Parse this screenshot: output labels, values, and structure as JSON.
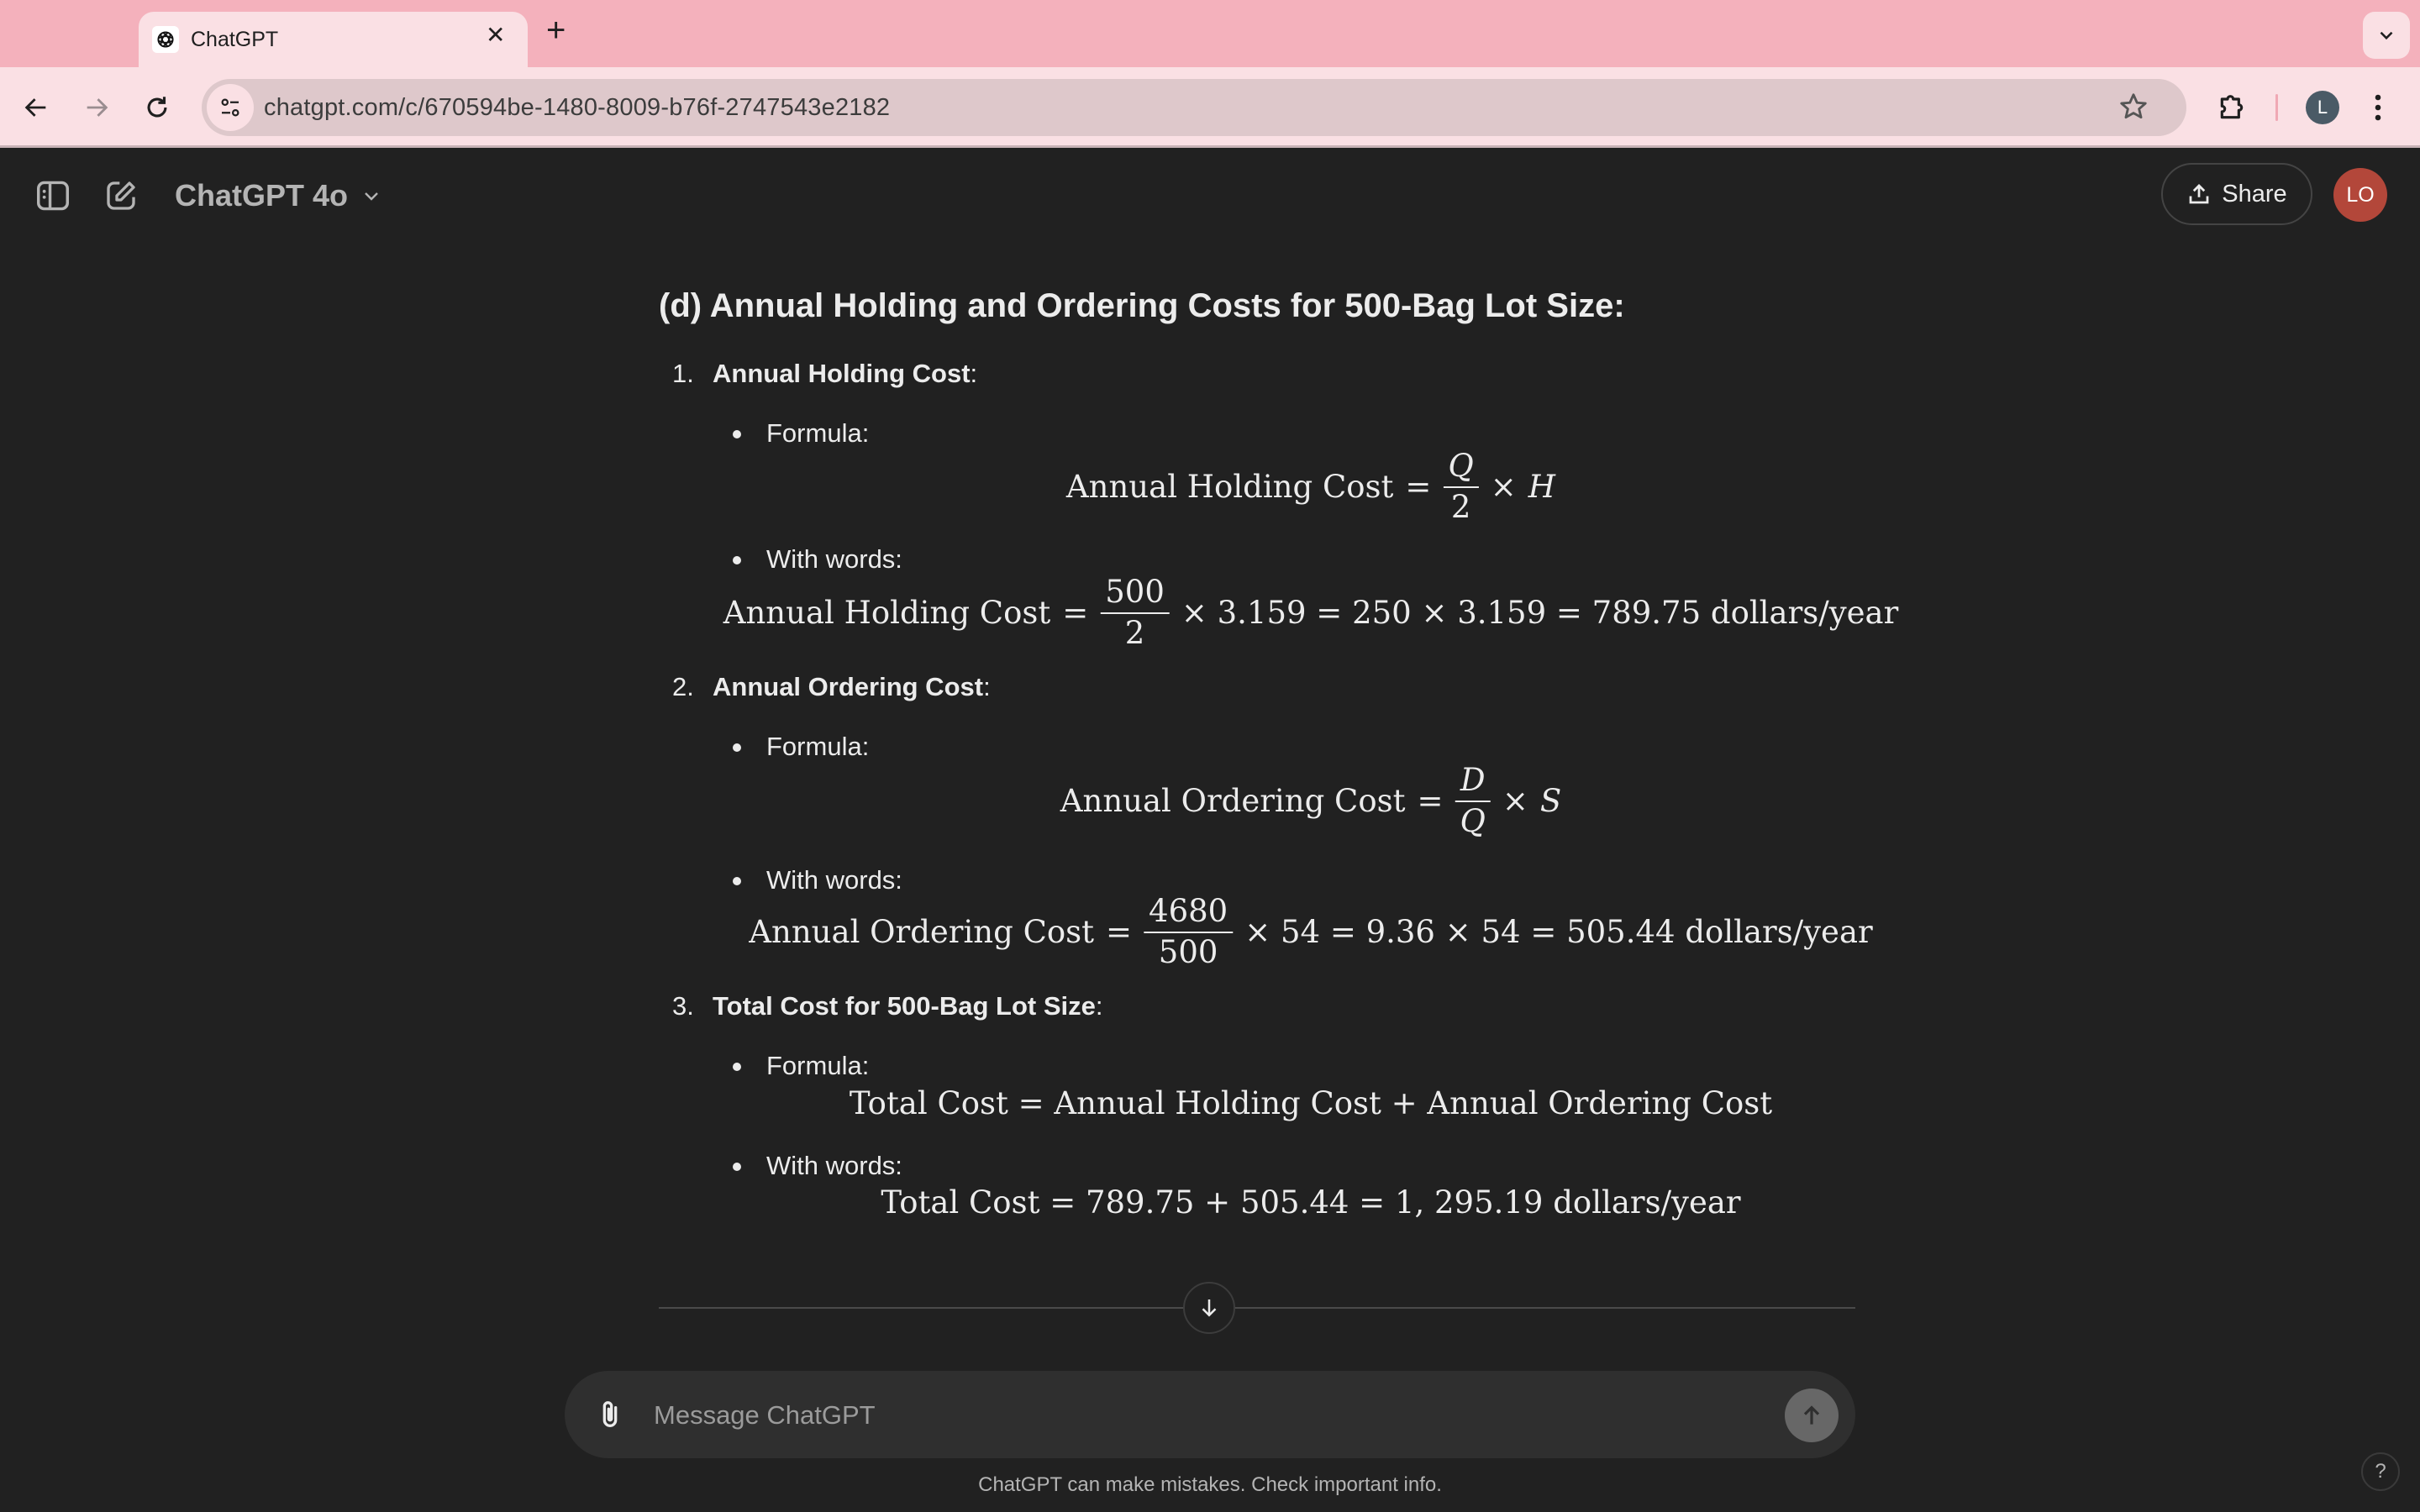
{
  "browser": {
    "tab_title": "ChatGPT",
    "url": "chatgpt.com/c/670594be-1480-8009-b76f-2747543e2182",
    "profile_initial": "L",
    "colors": {
      "tabstrip": "#f4b1bc",
      "toolbar": "#fae0e4",
      "omnibox": "#dec8cb"
    }
  },
  "header": {
    "model_label": "ChatGPT 4o",
    "share_label": "Share",
    "avatar_initials": "LO",
    "avatar_color": "#b3473a"
  },
  "content": {
    "heading": "(d) Annual Holding and Ordering Costs for 500-Bag Lot Size:",
    "items": [
      {
        "num": "1.",
        "title": "Annual Holding Cost",
        "formula_label": "Formula:",
        "formula": {
          "lhs": "Annual Holding Cost",
          "eq": "=",
          "num": "Q",
          "den": "2",
          "times": "×",
          "var": "H"
        },
        "words_label": "With words:",
        "words": {
          "lhs": "Annual Holding Cost",
          "eq": "=",
          "num": "500",
          "den": "2",
          "rest": "× 3.159 = 250 × 3.159 = 789.75 dollars/year"
        }
      },
      {
        "num": "2.",
        "title": "Annual Ordering Cost",
        "formula_label": "Formula:",
        "formula": {
          "lhs": "Annual Ordering Cost",
          "eq": "=",
          "num": "D",
          "den": "Q",
          "times": "×",
          "var": "S"
        },
        "words_label": "With words:",
        "words": {
          "lhs": "Annual Ordering Cost",
          "eq": "=",
          "num": "4680",
          "den": "500",
          "rest": "× 54 = 9.36 × 54 = 505.44 dollars/year"
        }
      },
      {
        "num": "3.",
        "title": "Total Cost for 500-Bag Lot Size",
        "formula_label": "Formula:",
        "formula_text": "Total Cost = Annual Holding Cost + Annual Ordering Cost",
        "words_label": "With words:",
        "words_text": "Total Cost = 789.75 + 505.44 = 1, 295.19 dollars/year"
      }
    ],
    "colon": ":"
  },
  "composer": {
    "placeholder": "Message ChatGPT"
  },
  "footer": {
    "disclaimer": "ChatGPT can make mistakes. Check important info.",
    "help": "?"
  }
}
